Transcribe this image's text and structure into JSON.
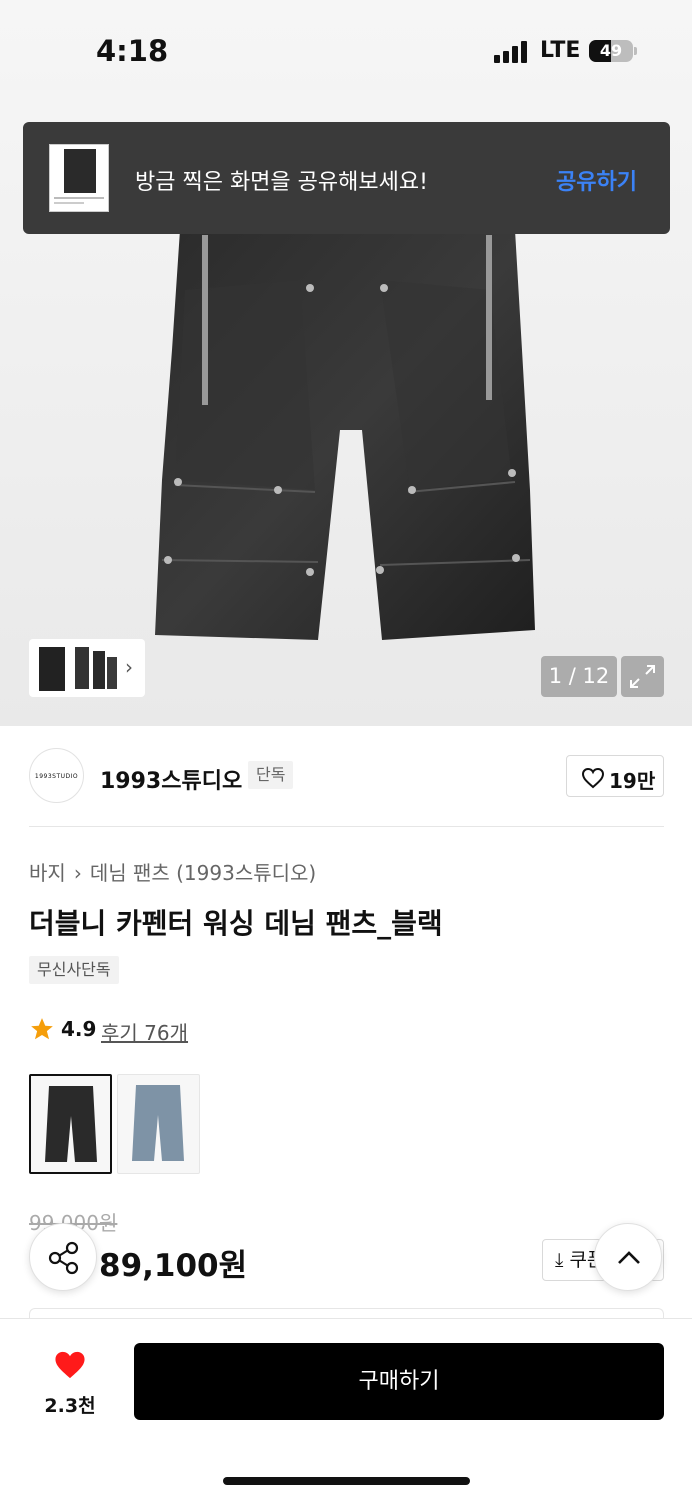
{
  "status_bar": {
    "time": "4:18",
    "network": "LTE",
    "battery": "49",
    "battery_level_percent": 49
  },
  "share_toast": {
    "message": "방금 찍은 화면을 공유해보세요!",
    "action": "공유하기",
    "action_color": "#3b82f6"
  },
  "gallery": {
    "pager": "1 / 12",
    "thumbnail_chevron": "chevron-right-icon",
    "expand_icon": "expand-icon"
  },
  "brand": {
    "logo_text": "1993STUDIO",
    "name": "1993스튜디오",
    "badge": "단독",
    "like_count": "19만"
  },
  "product": {
    "breadcrumb": [
      "바지",
      "데님 팬츠 (1993스튜디오)"
    ],
    "title": "더블니 카펜터 워싱 데님 팬츠_블랙",
    "exclusive_tag": "무신사단독",
    "rating": "4.9",
    "reviews": "후기 76개",
    "variants": [
      {
        "name": "black",
        "color": "#2a2a2a"
      },
      {
        "name": "light-blue",
        "color": "#7e93a6"
      }
    ],
    "original_price": "99,000원",
    "sale_price": "89,100원",
    "coupon_label": "쿠폰"
  },
  "bottom_bar": {
    "wish_count": "2.3천",
    "buy_label": "구매하기",
    "heart_color": "#ff1a1a"
  }
}
